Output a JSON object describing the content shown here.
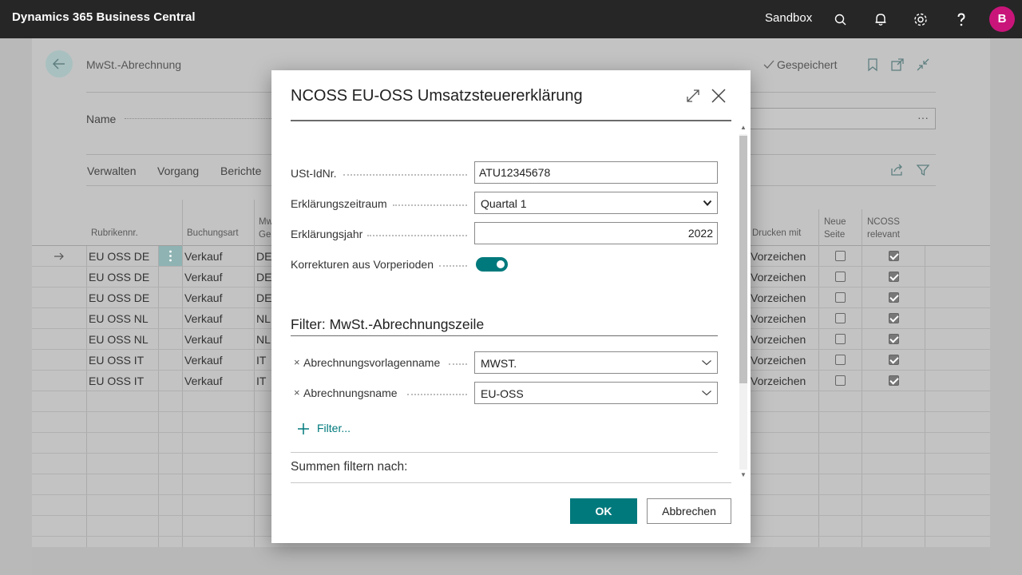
{
  "topbar": {
    "app_title": "Dynamics 365 Business Central",
    "environment": "Sandbox",
    "avatar_initial": "B",
    "icons": [
      "search-icon",
      "bell-icon",
      "gear-icon",
      "help-icon"
    ]
  },
  "page": {
    "title": "MwSt.-Abrechnung",
    "saved_label": "Gespeichert",
    "name_label": "Name",
    "name_field_more": "···",
    "menu": [
      "Verwalten",
      "Vorgang",
      "Berichte"
    ],
    "columns": {
      "rubrik": "Rubrikennr.",
      "buchungsart": "Buchungsart",
      "mw_line1": "Mw",
      "mw_line2": "Ge",
      "drucken": "Drucken mit",
      "neue_line1": "Neue",
      "neue_line2": "Seite",
      "ncoss_line1": "NCOSS",
      "ncoss_line2": "relevant"
    },
    "rows": [
      {
        "rubrik": "EU OSS DE",
        "buchungsart": "Verkauf",
        "mw": "DE",
        "drucken": "Vorzeichen",
        "neue_seite": false,
        "ncoss": true,
        "current": true
      },
      {
        "rubrik": "EU OSS DE",
        "buchungsart": "Verkauf",
        "mw": "DE",
        "drucken": "Vorzeichen",
        "neue_seite": false,
        "ncoss": true,
        "current": false
      },
      {
        "rubrik": "EU OSS DE",
        "buchungsart": "Verkauf",
        "mw": "DE",
        "drucken": "Vorzeichen",
        "neue_seite": false,
        "ncoss": true,
        "current": false
      },
      {
        "rubrik": "EU OSS NL",
        "buchungsart": "Verkauf",
        "mw": "NL",
        "drucken": "Vorzeichen",
        "neue_seite": false,
        "ncoss": true,
        "current": false
      },
      {
        "rubrik": "EU OSS NL",
        "buchungsart": "Verkauf",
        "mw": "NL",
        "drucken": "Vorzeichen",
        "neue_seite": false,
        "ncoss": true,
        "current": false
      },
      {
        "rubrik": "EU OSS IT",
        "buchungsart": "Verkauf",
        "mw": "IT",
        "drucken": "Vorzeichen",
        "neue_seite": false,
        "ncoss": true,
        "current": false
      },
      {
        "rubrik": "EU OSS IT",
        "buchungsart": "Verkauf",
        "mw": "IT",
        "drucken": "Vorzeichen",
        "neue_seite": false,
        "ncoss": true,
        "current": false
      }
    ]
  },
  "dialog": {
    "title": "NCOSS EU-OSS Umsatzsteuererklärung",
    "fields": {
      "ust_label": "USt-IdNr.",
      "ust_value": "ATU12345678",
      "zeitraum_label": "Erklärungszeitraum",
      "zeitraum_value": "Quartal 1",
      "jahr_label": "Erklärungsjahr",
      "jahr_value": "2022",
      "korrekturen_label": "Korrekturen aus Vorperioden",
      "korrekturen_on": true
    },
    "filter_section_title": "Filter: MwSt.-Abrechnungszeile",
    "filters": {
      "vorlage_label": "Abrechnungsvorlagenname",
      "vorlage_value": "MWST.",
      "name_label": "Abrechnungsname",
      "name_value": "EU-OSS",
      "remove_mark": "×"
    },
    "add_filter_label": "Filter...",
    "summen_label": "Summen filtern nach:",
    "ok_label": "OK",
    "cancel_label": "Abbrechen"
  },
  "colors": {
    "accent": "#00797c",
    "topbar": "#262626",
    "avatar": "#c9157a"
  }
}
